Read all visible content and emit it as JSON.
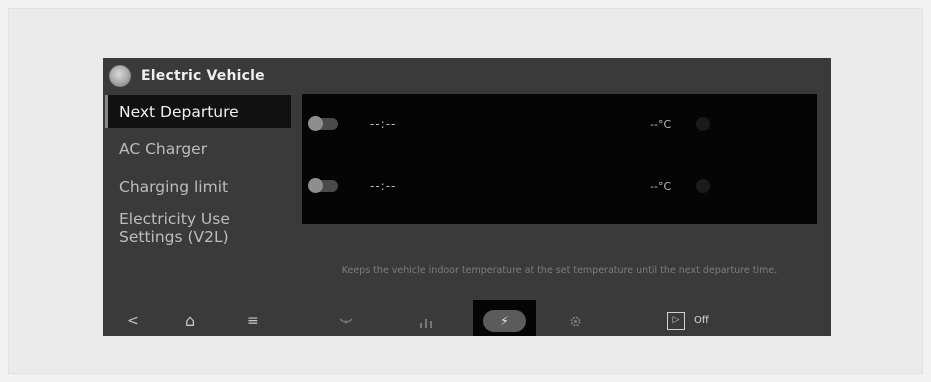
{
  "header": {
    "title": "Electric Vehicle",
    "icon": "ev-app-icon"
  },
  "sidebar": {
    "items": [
      {
        "label": "Next Departure",
        "active": true
      },
      {
        "label": "AC Charger",
        "active": false
      },
      {
        "label": "Charging limit",
        "active": false
      },
      {
        "label": "Electricity Use Settings (V2L)",
        "line1": "Electricity Use",
        "line2": "Settings (V2L)",
        "active": false
      }
    ]
  },
  "schedules": [
    {
      "time": "--:--",
      "temp": "--°C",
      "enabled": false
    },
    {
      "time": "--:--",
      "temp": "--°C",
      "enabled": false
    }
  ],
  "description": "Keeps the vehicle indoor temperature at the set temperature until the next departure time.",
  "navbar": {
    "back": "<",
    "home": "⌂",
    "menu": "≡",
    "fan_icon": "fan-icon",
    "stats_icon": "bar-chart-icon",
    "ev_icon": "ev-plug-icon",
    "ev_glyph": "⚡",
    "settings_icon": "gear-icon",
    "media_glyph": "▷",
    "media_state": "Off"
  },
  "colors": {
    "screen_bg": "#3a3a3a",
    "panel_bg": "#050505",
    "active_item_bg": "#111111"
  }
}
